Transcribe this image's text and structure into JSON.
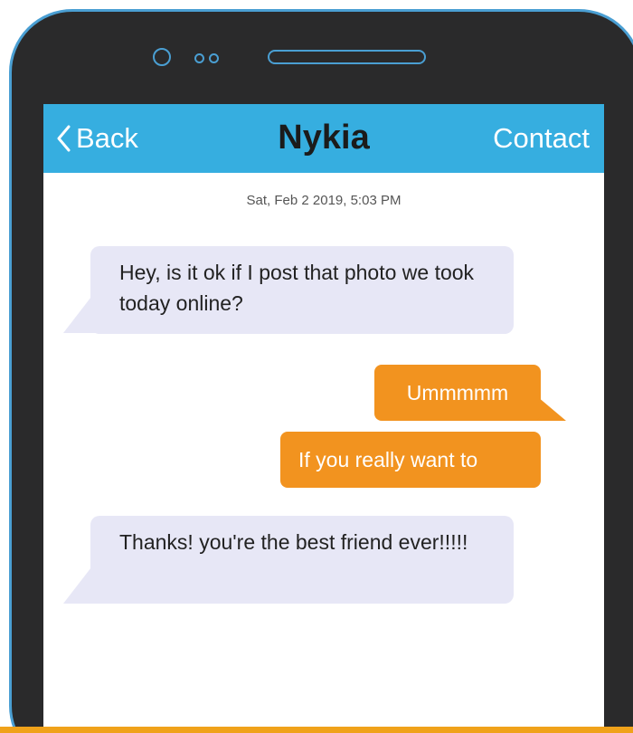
{
  "header": {
    "back_label": "Back",
    "title": "Nykia",
    "contact_label": "Contact"
  },
  "conversation": {
    "timestamp": "Sat, Feb 2 2019, 5:03 PM",
    "messages": [
      {
        "direction": "incoming",
        "text": "Hey, is it ok if I post that photo we took today online?"
      },
      {
        "direction": "outgoing",
        "text": "Ummmmm"
      },
      {
        "direction": "outgoing",
        "text": "If you really want to"
      },
      {
        "direction": "incoming",
        "text": "Thanks! you're the best friend ever!!!!!"
      }
    ]
  },
  "colors": {
    "header_bg": "#36aee0",
    "incoming_bubble": "#e7e7f6",
    "outgoing_bubble": "#f2931f",
    "phone_body": "#2a2a2b",
    "phone_outline": "#4a9fd3"
  },
  "icons": {
    "back": "chevron-left-icon",
    "camera": "front-camera-icon",
    "speaker": "earpiece-speaker-icon"
  }
}
